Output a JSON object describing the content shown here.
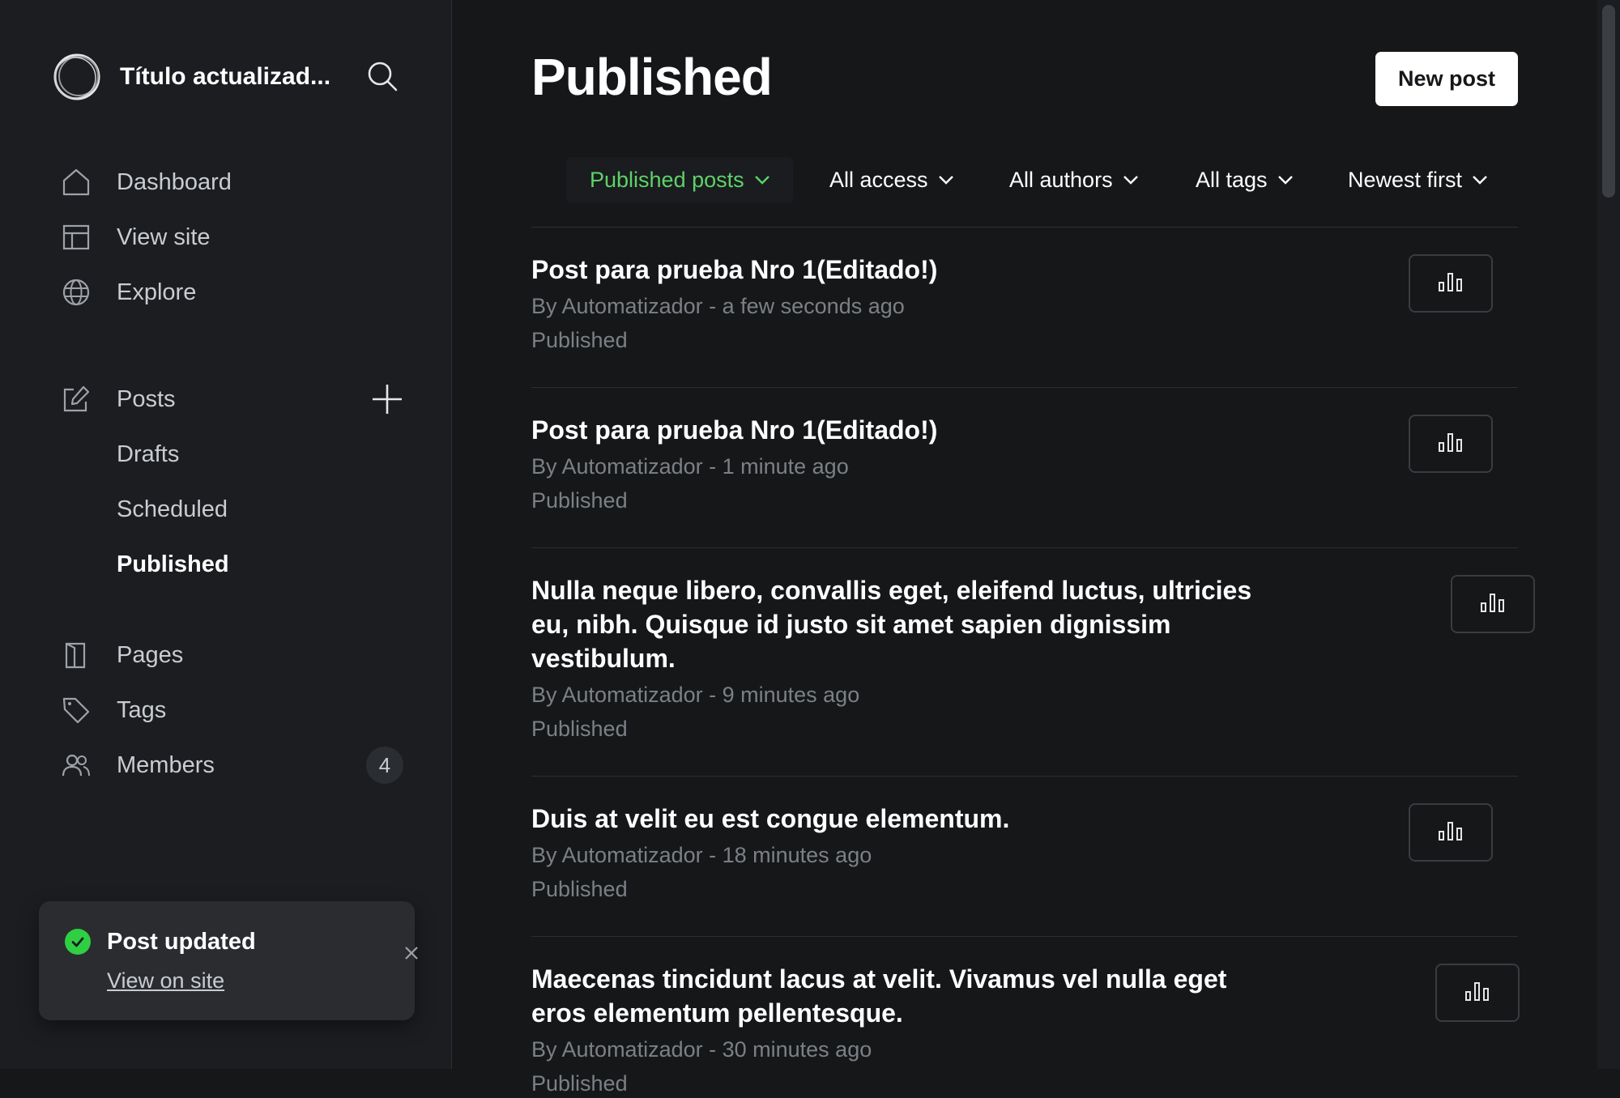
{
  "sidebar": {
    "site_title": "Título actualizad...",
    "nav": {
      "dashboard": "Dashboard",
      "view_site": "View site",
      "explore": "Explore",
      "posts": "Posts",
      "drafts": "Drafts",
      "scheduled": "Scheduled",
      "published": "Published",
      "pages": "Pages",
      "tags": "Tags",
      "members": "Members"
    },
    "members_count": "4"
  },
  "toast": {
    "title": "Post updated",
    "link": "View on site",
    "status_color": "#30cf43"
  },
  "main": {
    "title": "Published",
    "new_post": "New post",
    "filters": {
      "type": "Published posts",
      "access": "All access",
      "authors": "All authors",
      "tags": "All tags",
      "order": "Newest first"
    },
    "posts": [
      {
        "title": "Post para prueba Nro 1(Editado!)",
        "meta": "By Automatizador - a few seconds ago",
        "status": "Published"
      },
      {
        "title": "Post para prueba Nro 1(Editado!)",
        "meta": "By Automatizador - 1 minute ago",
        "status": "Published"
      },
      {
        "title": "Nulla neque libero, convallis eget, eleifend luctus, ultricies eu, nibh. Quisque id justo sit amet sapien dignissim vestibulum.",
        "meta": "By Automatizador - 9 minutes ago",
        "status": "Published"
      },
      {
        "title": "Duis at velit eu est congue elementum.",
        "meta": "By Automatizador - 18 minutes ago",
        "status": "Published"
      },
      {
        "title": "Maecenas tincidunt lacus at velit. Vivamus vel nulla eget eros elementum pellentesque.",
        "meta": "By Automatizador - 30 minutes ago",
        "status": "Published"
      }
    ]
  },
  "colors": {
    "background": "#151719",
    "sidebar": "#1b1d20",
    "accent_green": "#5ed268",
    "muted_text": "#7c8085"
  }
}
